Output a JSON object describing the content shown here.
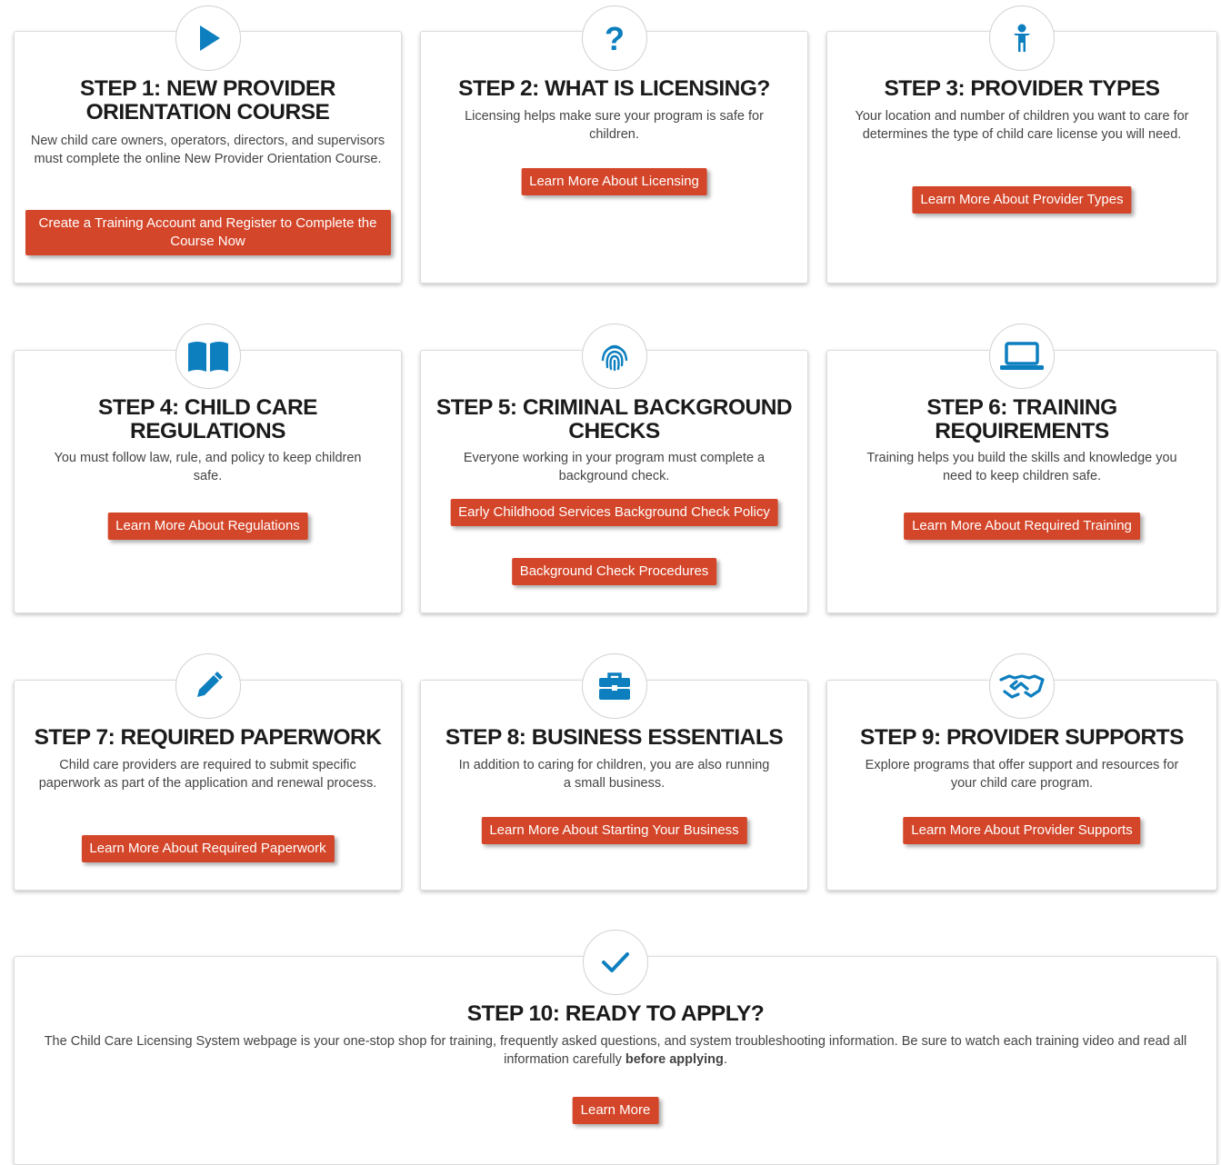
{
  "colors": {
    "accent_blue": "#0d7fbf",
    "button_red": "#d4462a",
    "title": "#1b1b1b"
  },
  "steps": [
    {
      "icon": "play-icon",
      "title": "STEP 1: NEW PROVIDER ORIENTATION COURSE",
      "description": "New child care owners, operators, directors, and supervisors must complete the online New Provider Orientation Course.",
      "buttons": [
        "Create a Training Account and Register to Complete the Course Now"
      ]
    },
    {
      "icon": "question-icon",
      "title": "STEP 2: WHAT IS LICENSING?",
      "description": "Licensing helps make sure your program is safe for children.",
      "buttons": [
        "Learn More About Licensing"
      ]
    },
    {
      "icon": "child-icon",
      "title": "STEP 3: PROVIDER TYPES",
      "description": "Your location and number of children you want to care for determines the type of child care license you will need.",
      "buttons": [
        "Learn More About Provider Types"
      ]
    },
    {
      "icon": "book-icon",
      "title": "STEP 4: CHILD CARE REGULATIONS",
      "description": "You must follow law, rule, and policy to keep children safe.",
      "buttons": [
        "Learn More About Regulations"
      ]
    },
    {
      "icon": "fingerprint-icon",
      "title": "STEP 5: CRIMINAL BACKGROUND CHECKS",
      "description": "Everyone working in your program must complete a background check.",
      "buttons": [
        "Early Childhood Services Background Check Policy",
        "Background Check Procedures"
      ]
    },
    {
      "icon": "laptop-icon",
      "title": "STEP 6: TRAINING REQUIREMENTS",
      "description": "Training helps you build the skills and knowledge you need to keep children safe.",
      "buttons": [
        "Learn More About Required Training"
      ]
    },
    {
      "icon": "pencil-icon",
      "title": "STEP 7: REQUIRED PAPERWORK",
      "description": "Child care providers are required to submit specific paperwork as part of the application and renewal process.",
      "buttons": [
        "Learn More About Required Paperwork"
      ]
    },
    {
      "icon": "briefcase-icon",
      "title": "STEP 8: BUSINESS ESSENTIALS",
      "description": "In addition to caring for children, you are also running a small business.",
      "buttons": [
        "Learn More About Starting Your Business"
      ]
    },
    {
      "icon": "handshake-icon",
      "title": "STEP 9: PROVIDER SUPPORTS",
      "description": "Explore programs that offer support and resources for your child care program.",
      "buttons": [
        "Learn More About Provider Supports"
      ]
    },
    {
      "icon": "checkmark-icon",
      "title": "STEP 10: READY TO APPLY?",
      "description": "The Child Care Licensing System webpage is your one-stop shop for training, frequently asked questions, and system troubleshooting information. Be sure to watch each training video and read all information carefully ",
      "description_bold": "before applying",
      "description_end": ".",
      "buttons": [
        "Learn More"
      ]
    }
  ]
}
